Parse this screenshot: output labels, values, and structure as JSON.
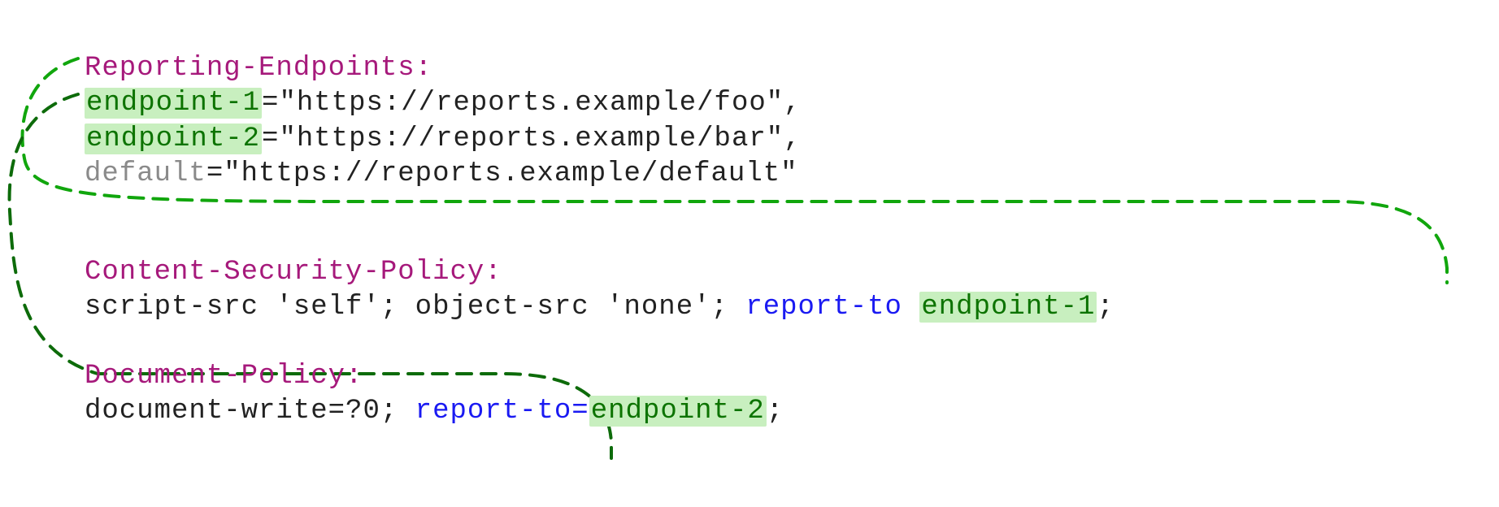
{
  "headers": {
    "reporting": {
      "name": "Reporting-Endpoints",
      "colon": ":",
      "endpoints": [
        {
          "key": "endpoint-1",
          "eq": "=",
          "url": "\"https://reports.example/foo\"",
          "comma": ","
        },
        {
          "key": "endpoint-2",
          "eq": "=",
          "url": "\"https://reports.example/bar\"",
          "comma": ","
        },
        {
          "key": "default",
          "eq": "=",
          "url": "\"https://reports.example/default\"",
          "comma": ""
        }
      ]
    },
    "csp": {
      "name": "Content-Security-Policy",
      "colon": ":",
      "body_prefix": "script-src 'self'; object-src 'none'; ",
      "report_to": "report-to ",
      "target": "endpoint-1",
      "semi": ";"
    },
    "docpolicy": {
      "name": "Document-Policy",
      "colon": ":",
      "body_prefix": "document-write=?0; ",
      "report_to": "report-to=",
      "target": "endpoint-2",
      "semi": ";"
    }
  }
}
